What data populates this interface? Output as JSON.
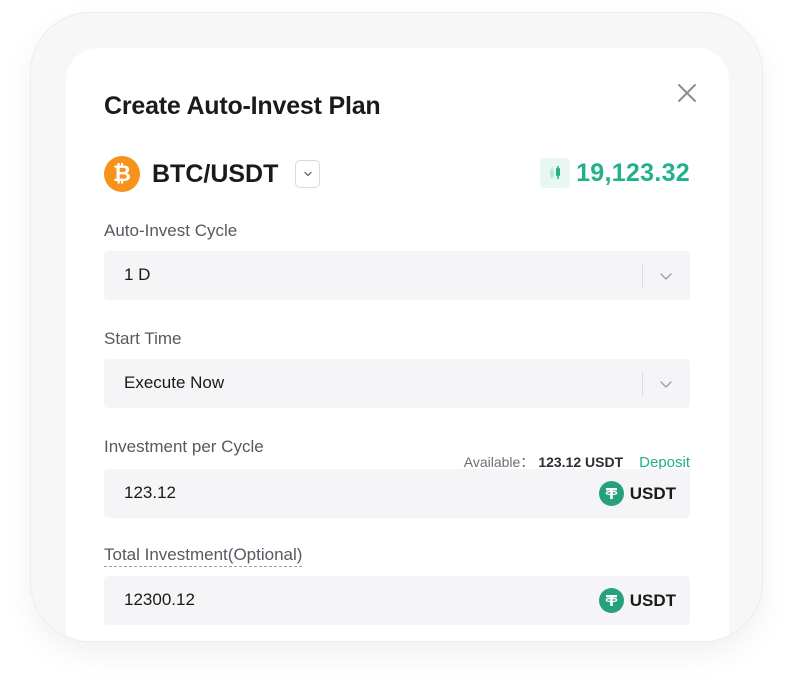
{
  "modal": {
    "title": "Create Auto-Invest Plan"
  },
  "pair": {
    "coin_symbol": "₿",
    "name": "BTC/USDT",
    "price": "19,123.32"
  },
  "cycle": {
    "label": "Auto-Invest Cycle",
    "value": "1 D"
  },
  "start_time": {
    "label": "Start Time",
    "value": "Execute Now"
  },
  "investment": {
    "label": "Investment per Cycle",
    "available_label": "Available：",
    "available_amount": "123.12 USDT",
    "deposit_label": "Deposit",
    "value": "123.12",
    "unit": "USDT"
  },
  "total": {
    "label": "Total Investment(Optional)",
    "value": "12300.12",
    "unit": "USDT"
  },
  "colors": {
    "accent": "#20b08a",
    "btc": "#f7931a",
    "tether": "#26a17b"
  },
  "icons": {
    "close": "close-icon",
    "dropdown": "chevron-down-icon",
    "price": "candlestick-icon",
    "coin": "bitcoin-icon",
    "currency": "tether-icon"
  }
}
